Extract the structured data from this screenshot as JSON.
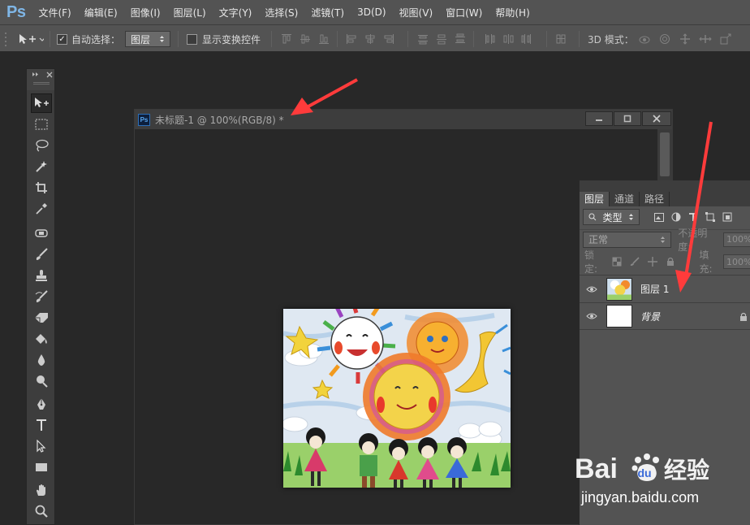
{
  "app": {
    "logo": "Ps"
  },
  "menubar": {
    "items": [
      {
        "label": "文件(F)"
      },
      {
        "label": "编辑(E)"
      },
      {
        "label": "图像(I)"
      },
      {
        "label": "图层(L)"
      },
      {
        "label": "文字(Y)"
      },
      {
        "label": "选择(S)"
      },
      {
        "label": "滤镜(T)"
      },
      {
        "label": "3D(D)"
      },
      {
        "label": "视图(V)"
      },
      {
        "label": "窗口(W)"
      },
      {
        "label": "帮助(H)"
      }
    ]
  },
  "options_bar": {
    "auto_select_label": "自动选择：",
    "auto_select_checked": true,
    "auto_select_target": "图层",
    "show_transform_label": "显示变换控件",
    "show_transform_checked": false,
    "mode_3d_label": "3D 模式："
  },
  "document": {
    "title": "未标题-1 @ 100%(RGB/8) *",
    "icon_label": "Ps"
  },
  "layers_panel": {
    "tabs": [
      {
        "label": "图层",
        "active": true
      },
      {
        "label": "通道",
        "active": false
      },
      {
        "label": "路径",
        "active": false
      }
    ],
    "filter_label": "类型",
    "blend_mode": "正常",
    "opacity_label": "不透明度:",
    "opacity_value": "100%",
    "lock_label": "锁定:",
    "fill_label": "填充:",
    "fill_value": "100%",
    "layers": [
      {
        "name": "图层 1",
        "visible": true,
        "locked": false
      },
      {
        "name": "背景",
        "visible": true,
        "locked": true
      }
    ]
  },
  "watermark": {
    "brand": "Baidu经验",
    "url": "jingyan.baidu.com"
  },
  "colors": {
    "ui_dark": "#282828",
    "ui_panel": "#535353",
    "annotation_arrow": "#ff3b3b"
  }
}
